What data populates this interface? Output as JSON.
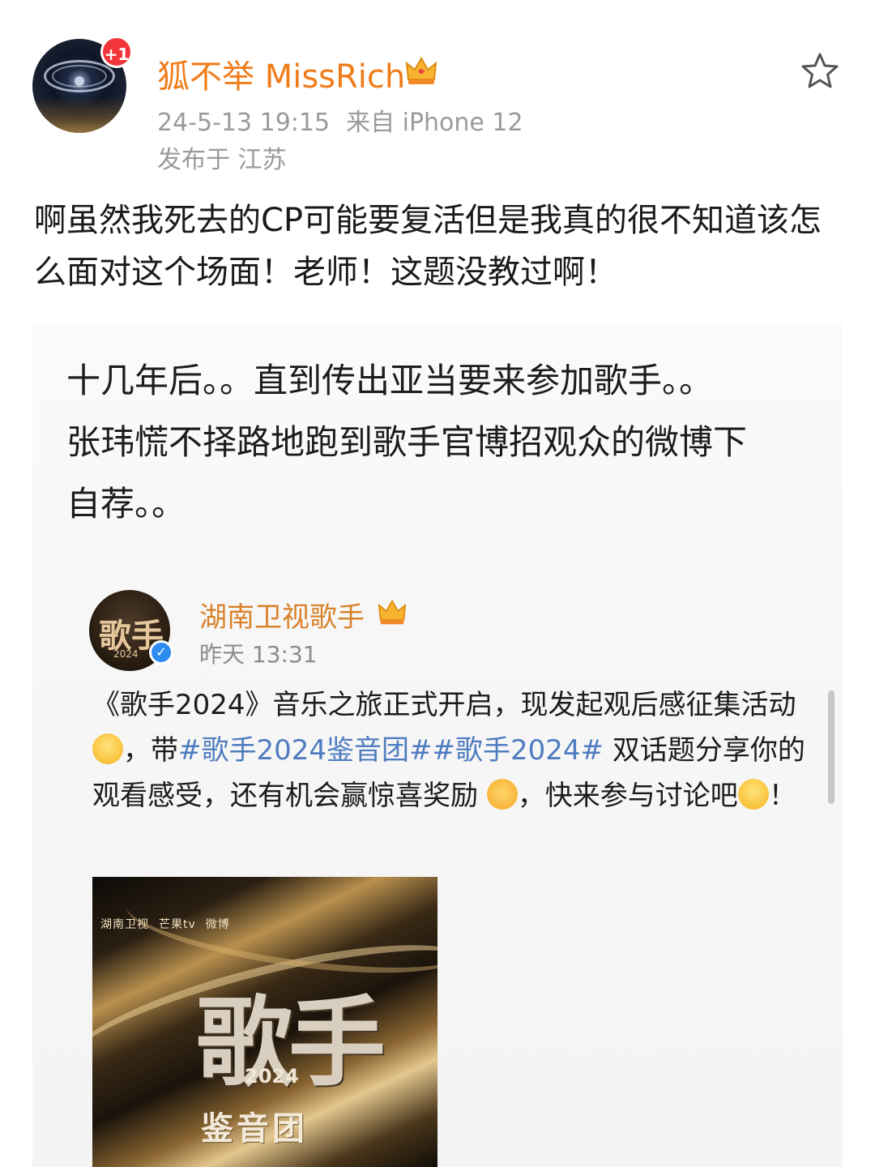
{
  "post": {
    "avatar_badge": "+1",
    "username": "狐不举 MissRich",
    "timestamp": "24-5-13 19:15",
    "source": "来自 iPhone 12",
    "location": "发布于 江苏",
    "text": "啊虽然我死去的CP可能要复活但是我真的很不知道该怎么面对这个场面！老师！这题没教过啊！"
  },
  "quote": {
    "line1": "十几年后。。直到传出亚当要来参加歌手。。",
    "line2": "张玮慌不择路地跑到歌手官博招观众的微博下",
    "line3": "自荐。。"
  },
  "repost": {
    "name": "湖南卫视歌手",
    "time": "昨天 13:31",
    "avatar_text": "歌手",
    "avatar_year": "2024",
    "text_part1": "《歌手2024》音乐之旅正式开启，现发起观后感征集活动",
    "text_part2": "，带",
    "tag1": "#歌手2024鉴音团#",
    "tag2": "#歌手2024#",
    "text_part3": "双话题分享你的观看感受，还有机会赢惊喜奖励",
    "text_part4": "，快来参与讨论吧",
    "text_part5": "！"
  },
  "poster": {
    "logo1": "湖南卫视",
    "logo2": "芒果tv",
    "logo3": "微博",
    "title": "歌手",
    "year": "2024",
    "subtitle": "鉴音团"
  },
  "colors": {
    "username": "#f07c1a",
    "meta": "#9a9a9a",
    "hashtag": "#4f7cc0",
    "badge": "#f2353a",
    "verified": "#2d8cf0"
  },
  "icons": {
    "favorite": "star-icon",
    "vip": "crown-icon",
    "verified": "verified-icon"
  }
}
